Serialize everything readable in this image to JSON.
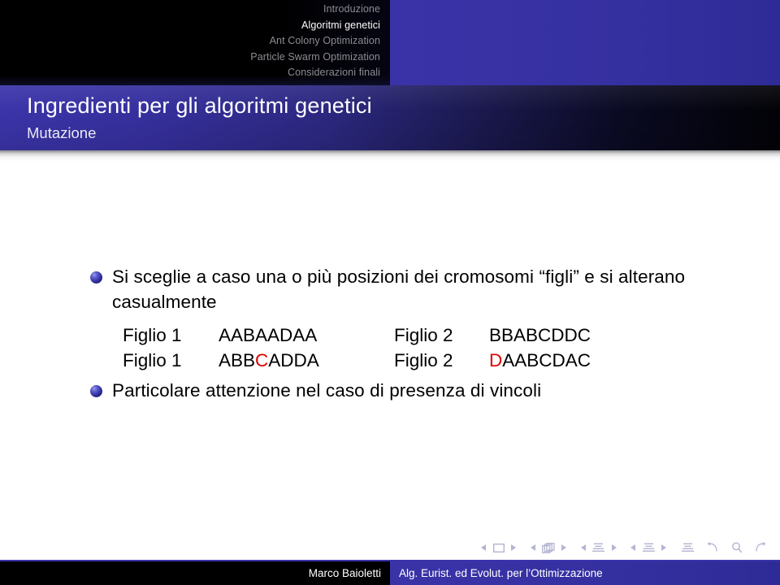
{
  "header": {
    "nav_items": [
      {
        "label": "Introduzione",
        "active": false
      },
      {
        "label": "Algoritmi genetici",
        "active": true
      },
      {
        "label": "Ant Colony Optimization",
        "active": false
      },
      {
        "label": "Particle Swarm Optimization",
        "active": false
      },
      {
        "label": "Considerazioni finali",
        "active": false
      }
    ],
    "panel_color": "#3530a0"
  },
  "titlebar": {
    "title": "Ingredienti per gli algoritmi genetici",
    "subtitle": "Mutazione",
    "gradient_start": "#3b34aa",
    "gradient_end": "#020206"
  },
  "content": {
    "bullets": [
      {
        "text": "Si sceglie a caso una o più posizioni dei cromosomi “figli” e si alterano casualmente"
      },
      {
        "text": "Particolare attenzione nel caso di presenza di vincoli"
      }
    ],
    "chromosomes": {
      "rows": [
        {
          "label_a": "Figlio 1",
          "seq_a_pre": "AABAADAA",
          "seq_a_mut": "",
          "seq_a_post": "",
          "label_b": "Figlio 2",
          "seq_b_pre": "BBABCDDC",
          "seq_b_mut": "",
          "seq_b_post": ""
        },
        {
          "label_a": "Figlio 1",
          "seq_a_pre": "ABB",
          "seq_a_mut": "C",
          "seq_a_post": "ADDA",
          "label_b": "Figlio 2",
          "seq_b_pre": "",
          "seq_b_mut": "D",
          "seq_b_post": "AABCDAC"
        }
      ],
      "mutation_color": "#dd0000"
    },
    "bullet_color": "#312f9e"
  },
  "navsymbols": {
    "groups": [
      {
        "icon": "slide-icon",
        "left_arrow": "◀",
        "right_arrow": "▶"
      },
      {
        "icon": "frame-stack-icon",
        "left_arrow": "◀",
        "right_arrow": "▶"
      },
      {
        "icon": "subsection-icon",
        "left_arrow": "◀",
        "right_arrow": "▶"
      },
      {
        "icon": "section-icon",
        "left_arrow": "◀",
        "right_arrow": "▶"
      }
    ],
    "singles": [
      "doc-icon",
      "back-icon",
      "search-icon",
      "forward-icon"
    ],
    "color": "#b4b4d2"
  },
  "footline": {
    "author": "Marco Baioletti",
    "title": "Alg. Eurist. ed Evolut. per l’Ottimizzazione",
    "author_bg": "#000000",
    "title_bg": "#3530a0"
  }
}
